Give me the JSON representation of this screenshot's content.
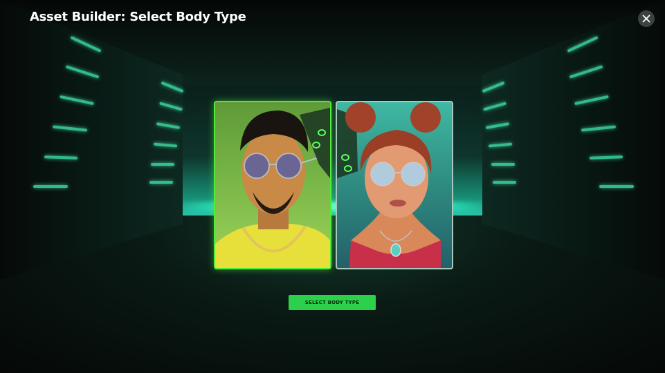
{
  "header": {
    "title": "Asset Builder: Select Body Type"
  },
  "cards": [
    {
      "id": "male",
      "selected": true
    },
    {
      "id": "female",
      "selected": false
    }
  ],
  "actions": {
    "select_label": "SELECT BODY TYPE"
  },
  "colors": {
    "accent": "#2bd14a",
    "selected_border": "#53ea3a",
    "neon": "#3fe3a8"
  },
  "icons": {
    "close": "close-icon"
  }
}
